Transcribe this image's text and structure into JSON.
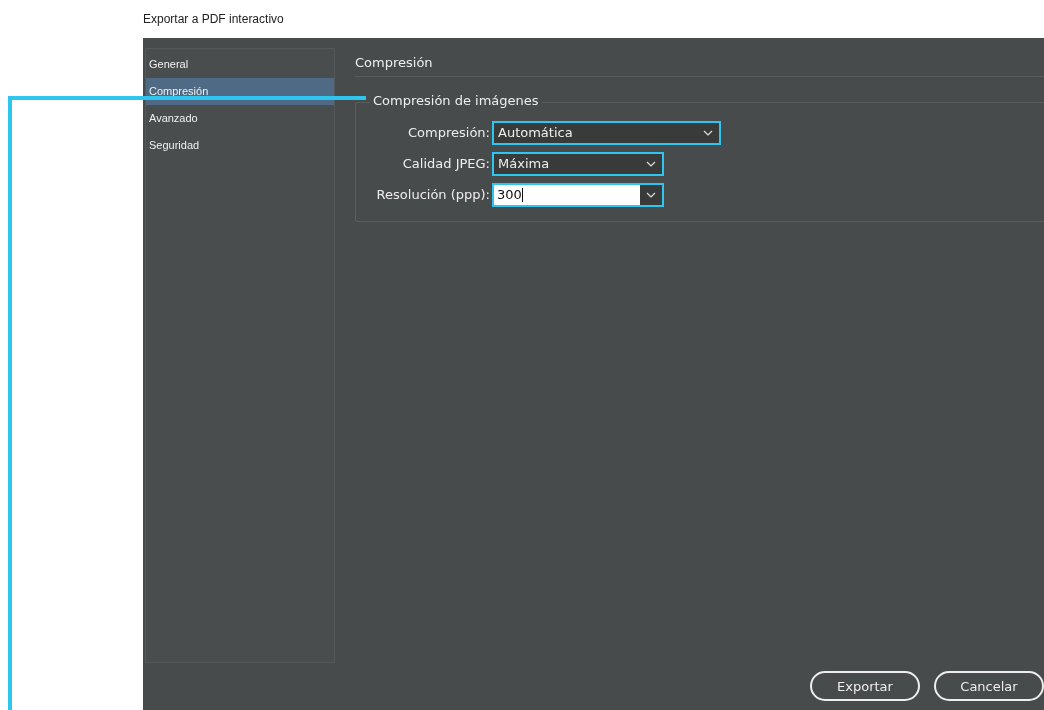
{
  "dialog_title": "Exportar a PDF interactivo",
  "sidebar": {
    "items": [
      {
        "label": "General",
        "selected": false
      },
      {
        "label": "Compresión",
        "selected": true
      },
      {
        "label": "Avanzado",
        "selected": false
      },
      {
        "label": "Seguridad",
        "selected": false
      }
    ]
  },
  "section_title": "Compresión",
  "group": {
    "title": "Compresión de imágenes",
    "fields": [
      {
        "label": "Compresión:",
        "value": "Automática",
        "kind": "dropdown",
        "highlighted": true
      },
      {
        "label": "Calidad JPEG:",
        "value": "Máxima",
        "kind": "dropdown",
        "highlighted": true
      },
      {
        "label": "Resolución (ppp):",
        "value": "300",
        "kind": "combo",
        "highlighted": true
      }
    ]
  },
  "buttons": [
    {
      "label": "Exportar"
    },
    {
      "label": "Cancelar"
    }
  ]
}
